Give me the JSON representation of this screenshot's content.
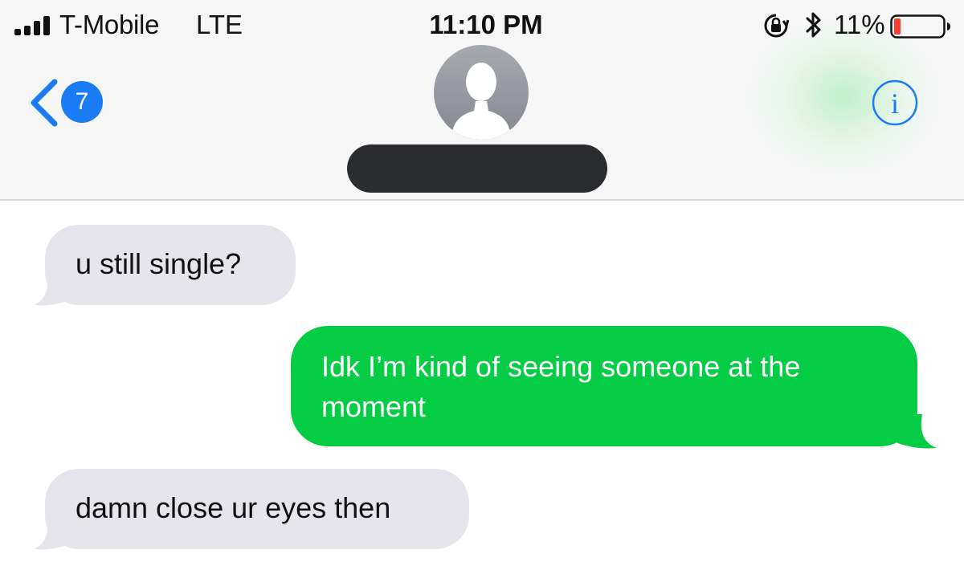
{
  "status_bar": {
    "carrier": "T-Mobile",
    "network": "LTE",
    "time": "11:10 PM",
    "battery_percent": "11%",
    "icons": [
      "signal-bars-icon",
      "rotation-lock-icon",
      "bluetooth-icon",
      "battery-low-icon"
    ]
  },
  "nav": {
    "back_icon": "chevron-left-icon",
    "unread_count": "7",
    "avatar_icon": "person-silhouette-icon",
    "info_icon": "info-icon"
  },
  "colors": {
    "outgoing_bubble": "#04cc44",
    "incoming_bubble": "#e6e5eb",
    "accent_blue": "#1a7cf5",
    "battery_low": "#ff3b30",
    "redaction": "#2a2c2f"
  },
  "messages": [
    {
      "direction": "incoming",
      "text": "u still single?"
    },
    {
      "direction": "outgoing",
      "text": "Idk I’m kind of seeing someone at the moment"
    },
    {
      "direction": "incoming",
      "text": "damn close ur eyes then"
    }
  ]
}
